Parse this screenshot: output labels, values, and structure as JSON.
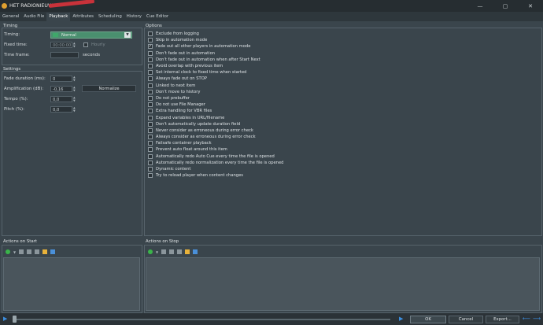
{
  "window": {
    "title": "HET RADIONIEUWS - ",
    "controls": [
      "—",
      "▢",
      "✕"
    ]
  },
  "tabs": [
    {
      "label": "General",
      "active": false
    },
    {
      "label": "Audio File",
      "active": false
    },
    {
      "label": "Playback",
      "active": true
    },
    {
      "label": "Attributes",
      "active": false
    },
    {
      "label": "Scheduling",
      "active": false
    },
    {
      "label": "History",
      "active": false
    },
    {
      "label": "Cue Editor",
      "active": false
    }
  ],
  "timing": {
    "group_title": "Timing",
    "timing_label": "Timing:",
    "timing_value": "Normal",
    "fixed_time_label": "Fixed time:",
    "fixed_time_value": "00:00:00",
    "hourly_label": "Hourly",
    "time_frame_label": "Time frame:",
    "time_frame_value": "",
    "time_frame_unit": "seconds"
  },
  "settings": {
    "group_title": "Settings",
    "fade_label": "Fade duration (ms):",
    "fade_value": "0",
    "amp_label": "Amplification (dB):",
    "amp_value": "-0,16",
    "normalize_label": "Normalize",
    "tempo_label": "Tempo (%):",
    "tempo_value": "0,0",
    "pitch_label": "Pitch (%):",
    "pitch_value": "0,0"
  },
  "options": {
    "group_title": "Options",
    "items": [
      {
        "label": "Exclude from logging",
        "checked": false
      },
      {
        "label": "Skip in automation mode",
        "checked": false
      },
      {
        "label": "Fade out all other players in automation mode",
        "checked": true
      },
      {
        "label": "Don't fade out in automation",
        "checked": false
      },
      {
        "label": "Don't fade out in automation when after Start Next",
        "checked": false
      },
      {
        "label": "Avoid overlap with previous item",
        "checked": false
      },
      {
        "label": "Set internal clock to fixed time when started",
        "checked": false
      },
      {
        "label": "Always fade out on STOP",
        "checked": false
      },
      {
        "label": "Linked to next item",
        "checked": false
      },
      {
        "label": "Don't move to history",
        "checked": false
      },
      {
        "label": "Do not prebuffer",
        "checked": false
      },
      {
        "label": "Do not use File Manager",
        "checked": false
      },
      {
        "label": "Extra handling for VBR files",
        "checked": false
      },
      {
        "label": "Expand variables in URL/filename",
        "checked": false
      },
      {
        "label": "Don't automatically update duration field",
        "checked": false
      },
      {
        "label": "Never consider as erroneous during error check",
        "checked": false
      },
      {
        "label": "Always consider as erroneous during error check",
        "checked": false
      },
      {
        "label": "Failsafe container playback",
        "checked": false
      },
      {
        "label": "Prevent auto float around this item",
        "checked": false
      },
      {
        "label": "Automatically redo Auto Cue every time the file is opened",
        "checked": false
      },
      {
        "label": "Automatically redo normalization every time the file is opened",
        "checked": false
      },
      {
        "label": "Dynamic content",
        "checked": false
      },
      {
        "label": "Try to reload player when content changes",
        "checked": false
      }
    ]
  },
  "actions_start": {
    "title": "Actions on Start"
  },
  "actions_stop": {
    "title": "Actions on Stop"
  },
  "footer": {
    "ok_label": "OK",
    "cancel_label": "Cancel",
    "export_label": "Export...",
    "play_icon": "▶",
    "arrow_icon": "⟵"
  },
  "colors": {
    "accent": "#4a8f6f",
    "background": "#3a454c"
  }
}
